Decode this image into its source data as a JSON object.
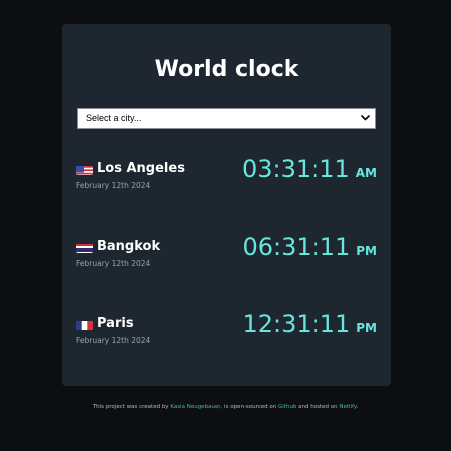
{
  "app": {
    "title": "World clock"
  },
  "city_select": {
    "selected_label": "Select a city..."
  },
  "cities": [
    {
      "name": "Los Angeles",
      "flag": "us-flag-icon",
      "date": "February 12th 2024",
      "time": "03:31:11",
      "ampm": "AM"
    },
    {
      "name": "Bangkok",
      "flag": "thailand-flag-icon",
      "date": "February 12th 2024",
      "time": "06:31:11",
      "ampm": "PM"
    },
    {
      "name": "Paris",
      "flag": "france-flag-icon",
      "date": "February 12th 2024",
      "time": "12:31:11",
      "ampm": "PM"
    }
  ],
  "footer": {
    "text_1": "This project was created by ",
    "author": "Kasia Neugebauer",
    "text_2": ", is open-sourced on ",
    "github": "Github",
    "text_3": " and hosted on ",
    "netlify": "Netlify",
    "text_4": "."
  },
  "colors": {
    "page_bg": "#0d0e12",
    "card_bg": "#1e2730",
    "time_accent": "#66e6dc",
    "link": "#4bb89c"
  }
}
